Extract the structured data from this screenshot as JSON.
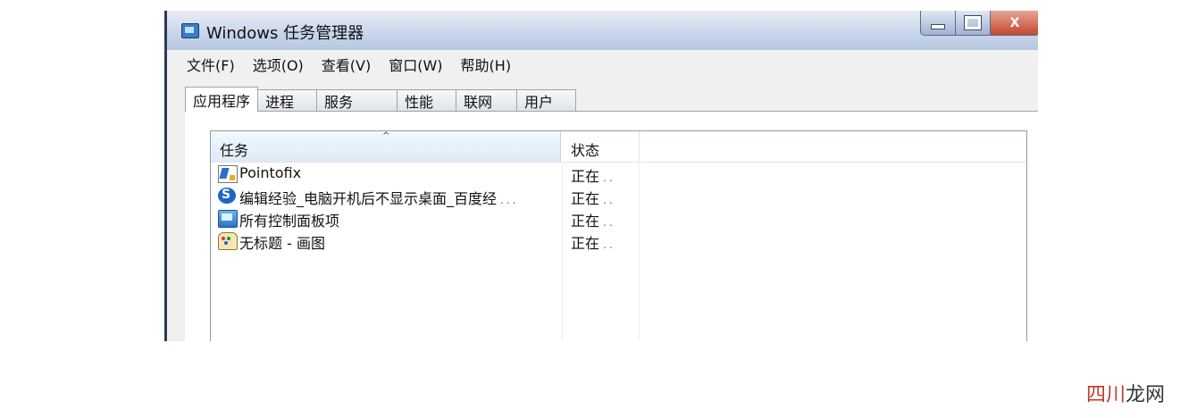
{
  "window": {
    "title": "Windows 任务管理器",
    "controls": {
      "minimize": "",
      "maximize": "",
      "close": "X"
    }
  },
  "menu": [
    "文件(F)",
    "选项(O)",
    "查看(V)",
    "窗口(W)",
    "帮助(H)"
  ],
  "tabs": [
    {
      "label": "应用程序",
      "active": true
    },
    {
      "label": "进程",
      "active": false
    },
    {
      "label": "服务",
      "active": false
    },
    {
      "label": "性能",
      "active": false
    },
    {
      "label": "联网",
      "active": false
    },
    {
      "label": "用户",
      "active": false
    }
  ],
  "list": {
    "columns": {
      "task": "任务",
      "status": "状态",
      "sort_indicator": "^"
    },
    "rows": [
      {
        "name": "Pointofix",
        "status": "正在",
        "icon": "pointofix-icon"
      },
      {
        "name": "编辑经验_电脑开机后不显示桌面_百度经",
        "status": "正在",
        "icon": "sogou-browser-icon"
      },
      {
        "name": "所有控制面板项",
        "status": "正在",
        "icon": "control-panel-icon"
      },
      {
        "name": "无标题 - 画图",
        "status": "正在",
        "icon": "paint-icon"
      }
    ],
    "truncation": "...",
    "status_ellipsis": ".."
  },
  "watermark": {
    "part1": "四川",
    "part2": "龙网"
  }
}
